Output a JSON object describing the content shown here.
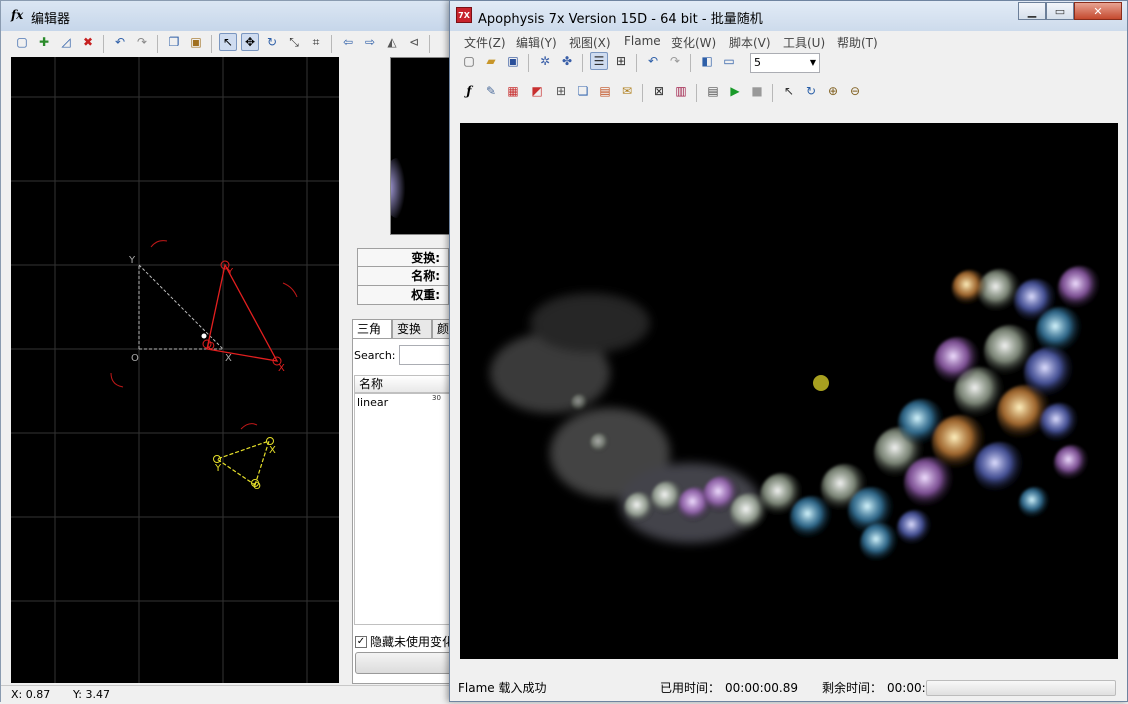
{
  "editor": {
    "title": "编辑器",
    "icon_label": "fx",
    "grid_labels": {
      "origin": "O",
      "x_axis": "X",
      "y_axis": "Y",
      "red_tri": [
        "O",
        "X",
        "Y"
      ],
      "yellow_tri": [
        "O",
        "X",
        "Y"
      ]
    },
    "status": {
      "x": "X: 0.87",
      "y": "Y: 3.47"
    },
    "props": {
      "transform": "变换:",
      "name": "名称:",
      "weight": "权重:"
    },
    "tabs": [
      "三角",
      "变换",
      "颜"
    ],
    "search_label": "Search:",
    "list_header": "名称",
    "list_items": [
      {
        "name": "linear",
        "value": "30"
      }
    ],
    "hide_unused": "隐藏未使用变化"
  },
  "apo": {
    "icon_label": "7X",
    "title": "Apophysis 7x Version 15D  - 64 bit - 批量随机",
    "menu": [
      "文件(Z)",
      "编辑(Y)",
      "视图(X)",
      "Flame",
      "变化(W)",
      "脚本(V)",
      "工具(U)",
      "帮助(T)"
    ],
    "combo_value": "5",
    "status": {
      "message": "Flame 载入成功",
      "elapsed_label": "已用时间：",
      "elapsed": "00:00:00.89",
      "remaining_label": "剩余时间：",
      "remaining": "00:00:"
    }
  },
  "colors": {
    "red_triangle": "#e21f1f",
    "yellow_triangle": "#e6e02a",
    "grid_line": "#3a3a3a",
    "render_bg": "#000000"
  }
}
